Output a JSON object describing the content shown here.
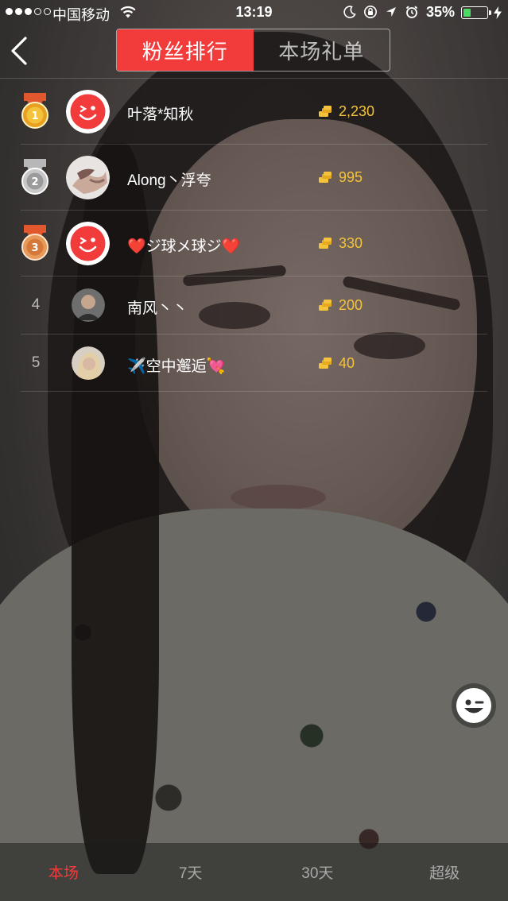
{
  "status_bar": {
    "signal_dots_filled": 3,
    "signal_dots_total": 5,
    "carrier": "中国移动",
    "time": "13:19",
    "battery_percent": "35%",
    "battery_level": 0.35,
    "icons": [
      "moon-icon",
      "orientation-lock-icon",
      "location-arrow-icon",
      "alarm-icon"
    ]
  },
  "header": {
    "back_icon": "chevron-left-icon",
    "tabs": [
      {
        "label": "粉丝排行",
        "active": true
      },
      {
        "label": "本场礼单",
        "active": false
      }
    ]
  },
  "ranking": {
    "coin_icon": "coin-stack-icon",
    "rows": [
      {
        "rank": "1",
        "medal": "gold",
        "nickname": "叶落*知秋",
        "avatar": "default-smiley-avatar",
        "value": "2,230"
      },
      {
        "rank": "2",
        "medal": "silver",
        "nickname": "Along丶浮夸",
        "avatar": "photo-hands-avatar",
        "value": "995"
      },
      {
        "rank": "3",
        "medal": "bronze",
        "nickname": "❤️ジ球メ球ジ❤️",
        "avatar": "default-smiley-avatar",
        "value": "330"
      },
      {
        "rank": "4",
        "medal": null,
        "nickname": "南风丶丶",
        "avatar": "photo-man-avatar",
        "value": "200"
      },
      {
        "rank": "5",
        "medal": null,
        "nickname": "✈️空中邂逅💘",
        "avatar": "photo-blonde-avatar",
        "value": "40"
      }
    ]
  },
  "floating": {
    "emoji_icon": "wink-face-icon"
  },
  "bottom_tabs": [
    {
      "label": "本场",
      "active": true
    },
    {
      "label": "7天",
      "active": false
    },
    {
      "label": "30天",
      "active": false
    },
    {
      "label": "超级",
      "active": false
    }
  ],
  "colors": {
    "accent": "#f23b3b",
    "coin": "#f5c33b",
    "gold_medal": "#e8a020",
    "silver_medal": "#c8c8c8",
    "bronze_medal": "#e89a5a",
    "battery_fill": "#4cd964"
  }
}
